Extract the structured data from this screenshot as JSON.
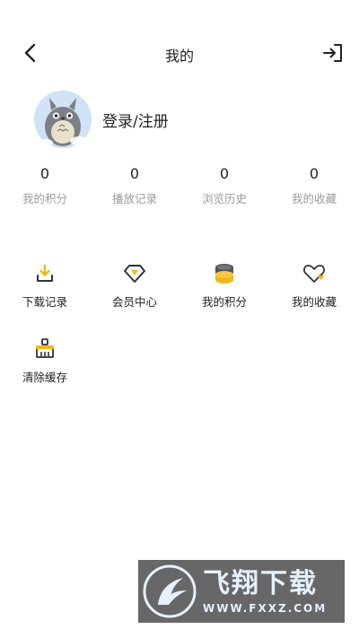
{
  "header": {
    "title": "我的",
    "back_icon": "chevron-left-icon",
    "login_icon": "sign-in-icon"
  },
  "profile": {
    "login_label": "登录/注册",
    "avatar_icon": "totoro-avatar"
  },
  "stats": [
    {
      "value": "0",
      "label": "我的积分"
    },
    {
      "value": "0",
      "label": "播放记录"
    },
    {
      "value": "0",
      "label": "浏览历史"
    },
    {
      "value": "0",
      "label": "我的收藏"
    }
  ],
  "menu": [
    {
      "label": "下载记录",
      "icon": "download-icon"
    },
    {
      "label": "会员中心",
      "icon": "diamond-icon"
    },
    {
      "label": "我的积分",
      "icon": "coins-icon"
    },
    {
      "label": "我的收藏",
      "icon": "heart-icon"
    },
    {
      "label": "清除缓存",
      "icon": "broom-icon"
    }
  ],
  "watermark": {
    "main": "飞翔下载",
    "sub": "WWW.FXXZ.COM"
  },
  "colors": {
    "accent_yellow": "#f0b81c",
    "dark_icon": "#333333",
    "stat_label": "#9a9a9a"
  }
}
